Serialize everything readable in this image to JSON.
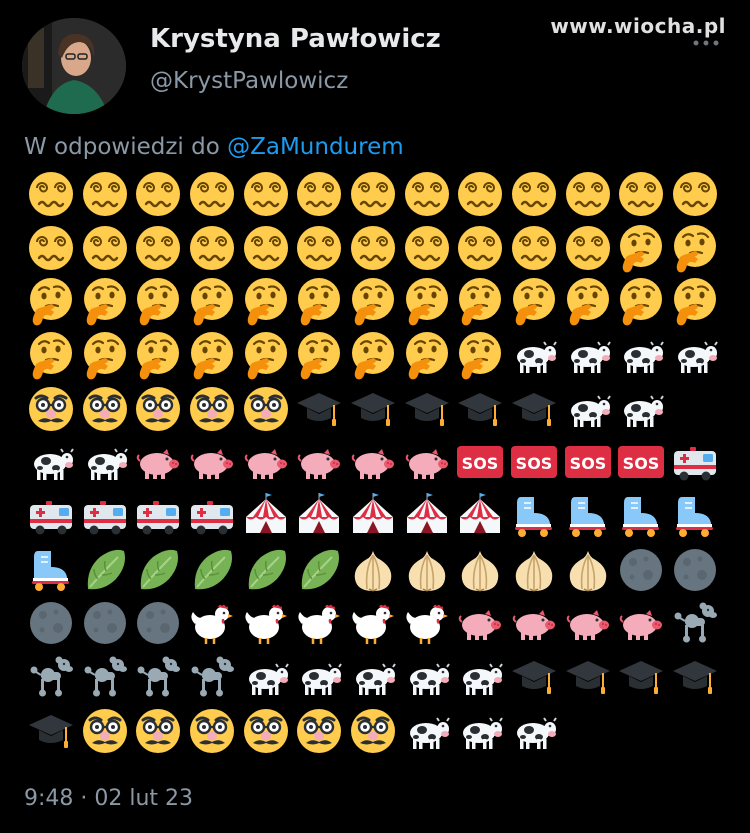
{
  "watermark": "www.wiocha.pl",
  "author": {
    "name": "Krystyna Pawłowicz",
    "handle": "@KrystPawlowicz"
  },
  "reply": {
    "prefix": "W odpowiedzi do ",
    "mention": "@ZaMundurem"
  },
  "emoji_rows": [
    [
      "dizzy-face",
      "dizzy-face",
      "dizzy-face",
      "dizzy-face",
      "dizzy-face",
      "dizzy-face",
      "dizzy-face",
      "dizzy-face",
      "dizzy-face",
      "dizzy-face",
      "dizzy-face",
      "dizzy-face",
      "dizzy-face"
    ],
    [
      "dizzy-face",
      "dizzy-face",
      "dizzy-face",
      "dizzy-face",
      "dizzy-face",
      "dizzy-face",
      "dizzy-face",
      "dizzy-face",
      "dizzy-face",
      "dizzy-face",
      "dizzy-face",
      "thinking-face",
      "thinking-face"
    ],
    [
      "thinking-face",
      "thinking-face",
      "thinking-face",
      "thinking-face",
      "thinking-face",
      "thinking-face",
      "thinking-face",
      "thinking-face",
      "thinking-face",
      "thinking-face",
      "thinking-face",
      "thinking-face",
      "thinking-face"
    ],
    [
      "thinking-face",
      "thinking-face",
      "thinking-face",
      "thinking-face",
      "thinking-face",
      "thinking-face",
      "thinking-face",
      "thinking-face",
      "thinking-face",
      "cow",
      "cow",
      "cow",
      "cow"
    ],
    [
      "disguised-face",
      "disguised-face",
      "disguised-face",
      "disguised-face",
      "disguised-face",
      "graduation-cap",
      "graduation-cap",
      "graduation-cap",
      "graduation-cap",
      "graduation-cap",
      "cow",
      "cow"
    ],
    [
      "cow",
      "cow",
      "pig",
      "pig",
      "pig",
      "pig",
      "pig",
      "pig",
      "sos",
      "sos",
      "sos",
      "sos",
      "ambulance"
    ],
    [
      "ambulance",
      "ambulance",
      "ambulance",
      "ambulance",
      "circus-tent",
      "circus-tent",
      "circus-tent",
      "circus-tent",
      "circus-tent",
      "roller-skate",
      "roller-skate",
      "roller-skate",
      "roller-skate"
    ],
    [
      "roller-skate",
      "leafy-green",
      "leafy-green",
      "leafy-green",
      "leafy-green",
      "leafy-green",
      "onion",
      "onion",
      "onion",
      "onion",
      "onion",
      "new-moon",
      "new-moon"
    ],
    [
      "new-moon",
      "new-moon",
      "new-moon",
      "chicken",
      "chicken",
      "chicken",
      "chicken",
      "chicken",
      "pig",
      "pig",
      "pig",
      "pig",
      "poodle"
    ],
    [
      "poodle",
      "poodle",
      "poodle",
      "poodle",
      "cow",
      "cow",
      "cow",
      "cow",
      "cow",
      "graduation-cap",
      "graduation-cap",
      "graduation-cap",
      "graduation-cap"
    ],
    [
      "graduation-cap",
      "disguised-face",
      "disguised-face",
      "disguised-face",
      "disguised-face",
      "disguised-face",
      "disguised-face",
      "cow",
      "cow",
      "cow"
    ]
  ],
  "sos_label": "SOS",
  "timestamp": "9:48 · 02 lut 23",
  "colors": {
    "background": "#000000",
    "text": "#e7e9ea",
    "muted": "#8b98a5",
    "mention": "#1d9bf0",
    "emoji_yellow": "#ffcc4d",
    "sos_red": "#dd2e44"
  }
}
